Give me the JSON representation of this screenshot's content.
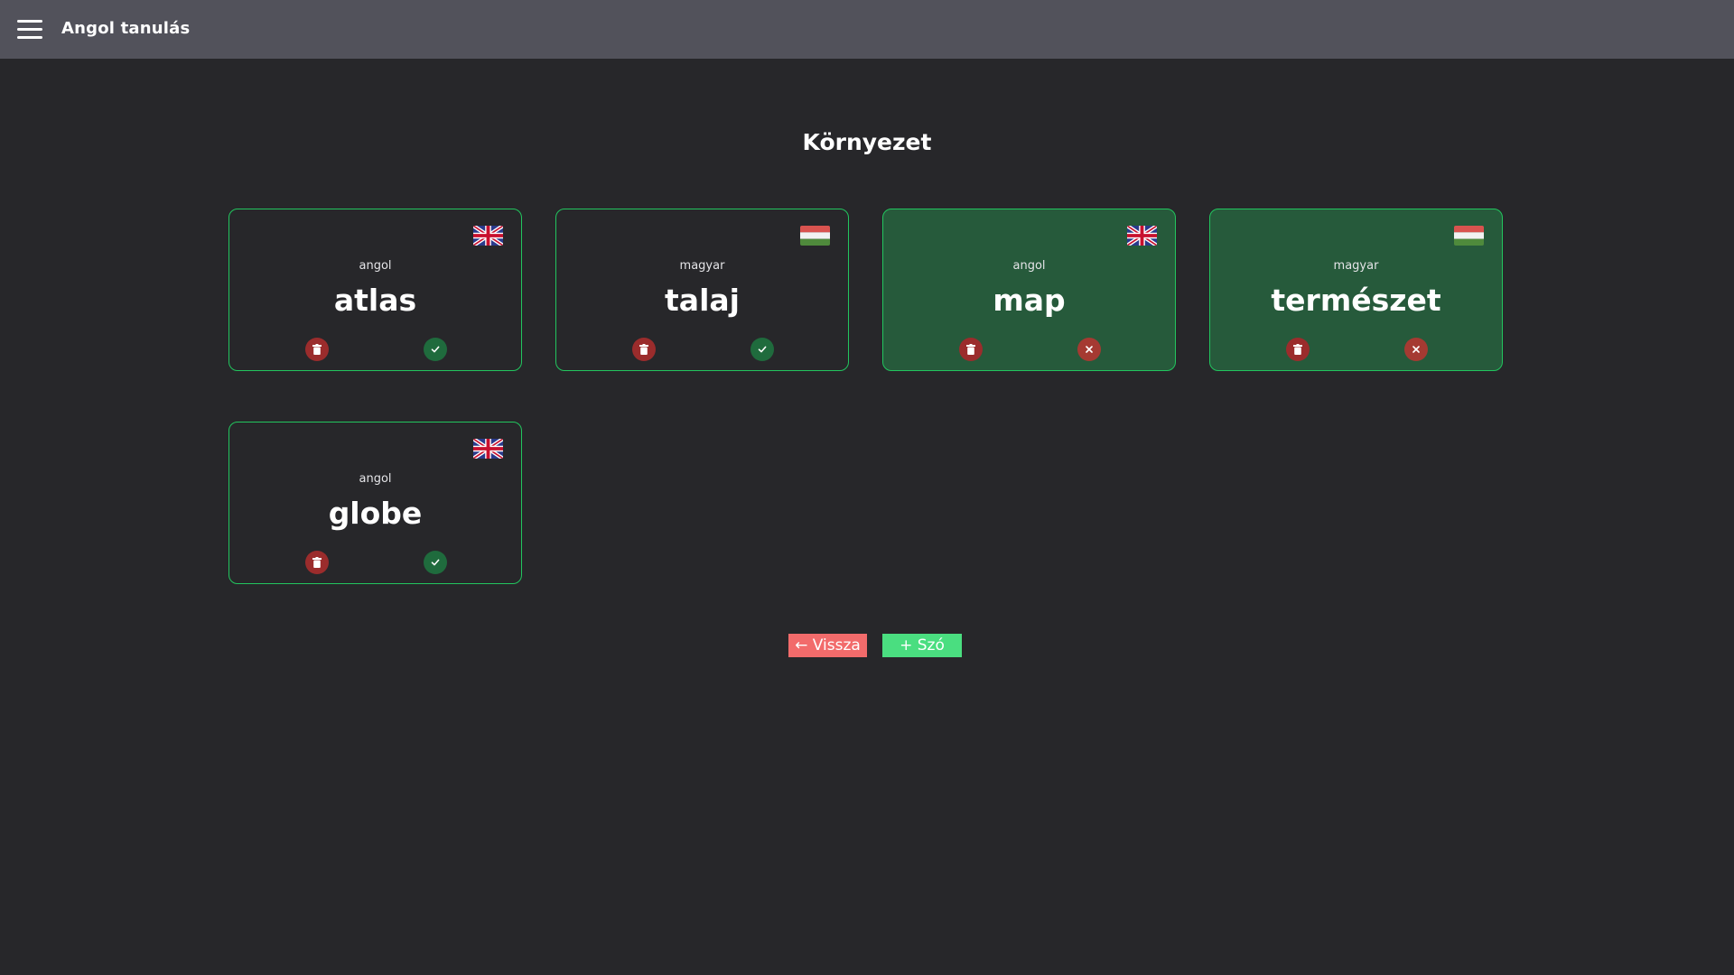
{
  "header": {
    "app_title": "Angol tanulás",
    "menu_icon": "hamburger-menu-icon"
  },
  "page": {
    "title": "Környezet"
  },
  "cards": [
    {
      "lang": "angol",
      "flag": "uk-flag-icon",
      "word": "atlas",
      "learned": false,
      "status_icon": "check-icon"
    },
    {
      "lang": "magyar",
      "flag": "hungary-flag-icon",
      "word": "talaj",
      "learned": false,
      "status_icon": "check-icon"
    },
    {
      "lang": "angol",
      "flag": "uk-flag-icon",
      "word": "map",
      "learned": true,
      "status_icon": "close-icon"
    },
    {
      "lang": "magyar",
      "flag": "hungary-flag-icon",
      "word": "természet",
      "learned": true,
      "status_icon": "close-icon"
    },
    {
      "lang": "angol",
      "flag": "uk-flag-icon",
      "word": "globe",
      "learned": false,
      "status_icon": "check-icon"
    }
  ],
  "buttons": {
    "back_label": "← Vissza",
    "add_label": "+ Szó"
  },
  "colors": {
    "background": "#27272a",
    "topbar": "#52525b",
    "card_border": "#22c55e",
    "card_learned_bg": "#265a3b",
    "delete_button": "#9b2c2c",
    "check_button": "#1f6b3d",
    "cross_button": "#a53a32",
    "back_button": "#f26b6b",
    "add_button": "#4ade80"
  }
}
